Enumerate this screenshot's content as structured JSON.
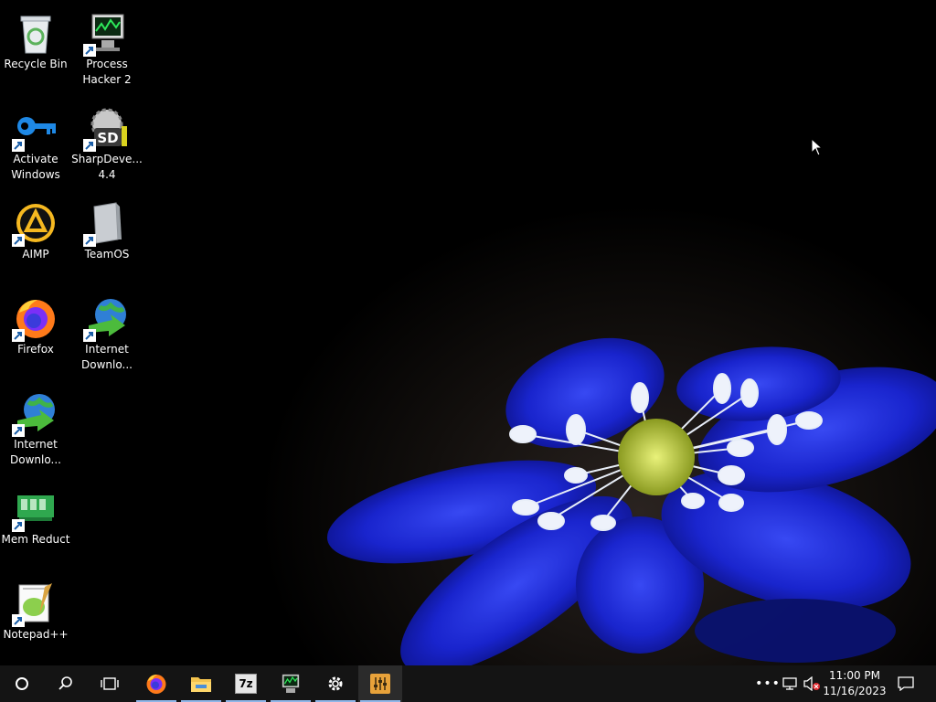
{
  "desktop": {
    "icons": [
      {
        "label": "Recycle Bin",
        "icon": "recycle-bin-icon"
      },
      {
        "label": "Process Hacker 2",
        "icon": "process-hacker-icon"
      },
      {
        "label": "Activate Windows",
        "icon": "key-icon"
      },
      {
        "label": "SharpDeve... 4.4",
        "icon": "sharpdevelop-icon"
      },
      {
        "label": "AIMP",
        "icon": "aimp-icon"
      },
      {
        "label": "TeamOS",
        "icon": "teamos-icon"
      },
      {
        "label": "Firefox",
        "icon": "firefox-icon"
      },
      {
        "label": "Internet Downlo...",
        "icon": "internet-download-manager-icon"
      },
      {
        "label": "Internet Downlo...",
        "icon": "internet-download-manager-icon"
      },
      {
        "label": "Mem Reduct",
        "icon": "mem-reduct-icon"
      },
      {
        "label": "Notepad++",
        "icon": "notepad-plus-plus-icon"
      }
    ]
  },
  "taskbar": {
    "start": "start-icon",
    "search": "search-icon",
    "task_view": "task-view-icon",
    "apps": [
      {
        "name": "Firefox",
        "icon": "firefox-icon",
        "open": true
      },
      {
        "name": "File Explorer",
        "icon": "folder-icon",
        "open": true
      },
      {
        "name": "7-Zip",
        "icon": "7zip-icon",
        "label": "7z",
        "open": true
      },
      {
        "name": "Process Hacker",
        "icon": "process-hacker-icon",
        "open": true
      },
      {
        "name": "Settings",
        "icon": "gear-icon",
        "open": true
      },
      {
        "name": "Mixer",
        "icon": "equalizer-icon",
        "open": true,
        "active": true
      }
    ],
    "tray": {
      "overflow": "more-icon",
      "network": "network-icon",
      "volume": "volume-muted-icon",
      "time": "11:00 PM",
      "date": "11/16/2023",
      "notifications": "notification-icon"
    }
  },
  "colors": {
    "taskbar_bg": "#141414",
    "open_indicator": "#8fb6e8",
    "flower": "#1f2fe0"
  }
}
